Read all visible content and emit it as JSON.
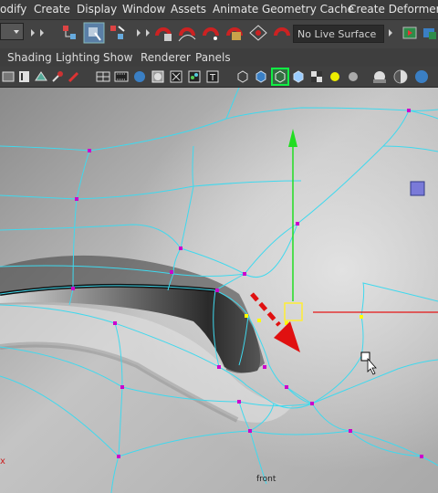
{
  "menu": {
    "items": [
      "odify",
      "Create",
      "Display",
      "Window",
      "Assets",
      "Animate",
      "Geometry Cache",
      "Create Deformers"
    ]
  },
  "status_line": {
    "live_surface": "No Live Surface"
  },
  "panel_menu": {
    "items": [
      "Shading",
      "Lighting",
      "Show",
      "Renderer",
      "Panels"
    ]
  },
  "viewport": {
    "camera_label": "front",
    "axis_marker": "x"
  },
  "colors": {
    "wireframe": "#3fd9ee",
    "vertex": "#cc00cc",
    "selected_vertex": "#ffff00",
    "manipulator_y": "#22dd22",
    "manipulator_x": "#e51414",
    "manipulator_center": "#ffee33",
    "annotation_arrow": "#e01010",
    "menu_bg": "#3c3c3c"
  },
  "icons": [
    "dropdown-icon",
    "select-by-hierarchy-icon",
    "select-by-object-icon",
    "select-by-component-icon",
    "snap-to-grid-icon",
    "snap-to-curve-icon",
    "snap-to-point-icon",
    "snap-to-view-plane-icon",
    "make-live-icon",
    "history-icon",
    "render-icon",
    "camera-select-icon",
    "camera-attr-icon",
    "bookmark-icon",
    "image-plane-icon",
    "2d-pan-zoom-icon",
    "grease-pencil-icon",
    "grid-icon",
    "film-gate-icon",
    "resolution-gate-icon",
    "safe-action-icon",
    "safe-title-icon",
    "wireframe-icon",
    "smooth-shade-icon",
    "wireframe-on-shaded-icon",
    "xray-icon",
    "textured-icon",
    "use-all-lights-icon",
    "shadows-icon",
    "screen-space-ao-icon",
    "motion-blur-icon",
    "anti-aliasing-icon",
    "depth-of-field-icon",
    "select-tool-cursor-icon"
  ]
}
